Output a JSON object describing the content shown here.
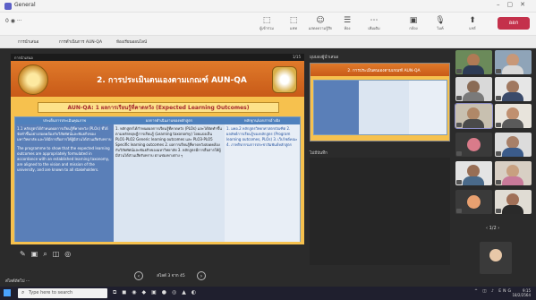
{
  "window": {
    "title": "General"
  },
  "toolbar": {
    "timer": "0 ◉ ···",
    "items": [
      {
        "icon": "⬚",
        "label": "ผู้เข้าร่วม"
      },
      {
        "icon": "⬚",
        "label": "แชท"
      },
      {
        "icon": "☺",
        "label": "แสดงความรู้สึก"
      },
      {
        "icon": "☰",
        "label": "ห้อง"
      },
      {
        "icon": "⋯",
        "label": "เพิ่มเติม"
      },
      {
        "icon": "▣",
        "label": "กล้อง"
      },
      {
        "icon": "🎙",
        "label": "ไมค์"
      },
      {
        "icon": "⬆",
        "label": "แชร์"
      }
    ],
    "leave_label": "ออก"
  },
  "tabs": [
    {
      "label": "การนำเสนอ"
    },
    {
      "label": "การดำเนินการ AUN-QA"
    },
    {
      "label": "ห้องเรียนออนไลน์"
    }
  ],
  "slide": {
    "header_left": "การนำเสนอ",
    "header_right": "1/15",
    "title": "2. การประเมินตนเองตามเกณฑ์ AUN-QA",
    "subtitle": "AUN-QA: 1 ผลการเรียนรู้ที่คาดหวัง (Expected Learning Outcomes)",
    "table": {
      "headers": [
        "ประเด็นการประเมินคุณภาพ",
        "ผลการดำเนินงานของหลักสูตร",
        "หลักฐาน/เอกสารอ้างอิง"
      ],
      "col1_thai": "1.1 หลักสูตรได้กำหนดผลการเรียนรู้ที่คาดหวัง (PLOs) ที่ได้จัดทำขึ้นอย่างสอดคล้องกับวิสัยทัศน์และพันธกิจของมหาวิทยาลัย และได้มีการสื่อสารให้ผู้มีส่วนได้ส่วนเสียรับทราบ",
      "col1_en": "The programme to show that the expected learning outcomes are appropriately formulated in accordance with an established learning taxonomy, are aligned to the vision and mission of the university, and are known to all stakeholders.",
      "col2": "1. หลักสูตรได้กำหนดผลการเรียนรู้ที่คาดหวัง (PLOs) และได้จัดทำขึ้นตามหลักทฤษฎีการเรียนรู้ (Learning taxonomy) โดยแบ่งเป็น PLO1-PLO2 Generic learning outcomes และ PLO3-PLO5 Specific learning outcomes 2. ผลการเรียนรู้ที่คาดหวังสอดคล้องกับวิสัยทัศน์และพันธกิจของมหาวิทยาลัย 3. หลักสูตรมีการสื่อสารให้ผู้มีส่วนได้ส่วนเสียรับทราบ ผ่านช่องทางต่าง ๆ",
      "col3": "1. มคอ.2 หลักสูตรวิทยาศาสตรบัณฑิต 2. ผลลัพธ์การเรียนรู้ของหลักสูตร (Program learning outcomes, PLOs) 3. เว็บไซต์คณะ 4. ภาพกิจกรรมการประชาสัมพันธ์หลักสูตร"
    }
  },
  "presenter": {
    "view_label": "มุมมองผู้นำเสนอ",
    "thumb_title": "2. การประเมินตนเองตามเกณฑ์ AUN-QA",
    "notes_label": "ไม่มีบันทึก"
  },
  "nav": {
    "label": "สไลด์ 3 จาก 45",
    "prev": "‹",
    "next": "›"
  },
  "bottom_left": "สไลด์ถัดไป ···",
  "panel": {
    "pager": "‹ 1/2 ›"
  },
  "taskbar": {
    "search_placeholder": "Type here to search",
    "tray": "^ ◫ ♪ ENG",
    "time": "9:15",
    "date": "18/2/2564"
  }
}
